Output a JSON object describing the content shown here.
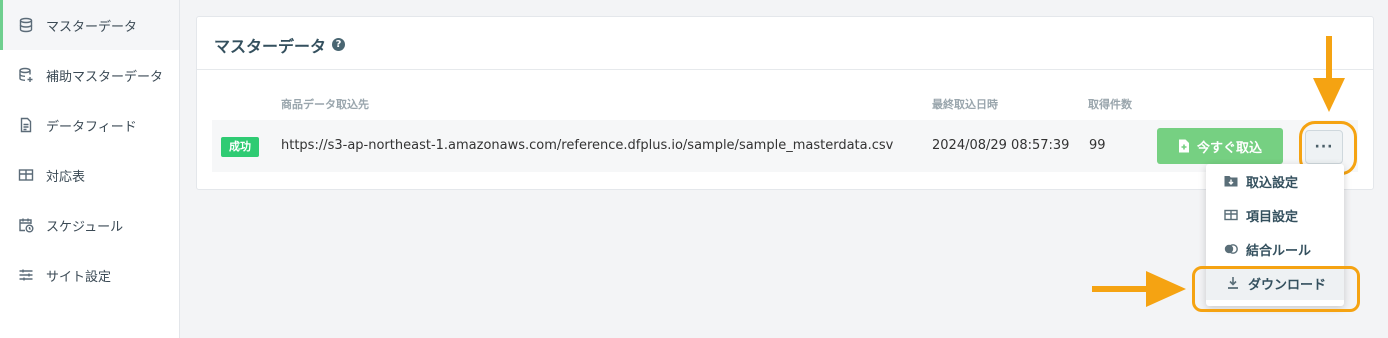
{
  "sidebar": {
    "items": [
      {
        "label": "マスターデータ",
        "icon": "database-icon",
        "active": true
      },
      {
        "label": "補助マスターデータ",
        "icon": "database-add-icon",
        "active": false
      },
      {
        "label": "データフィード",
        "icon": "document-icon",
        "active": false
      },
      {
        "label": "対応表",
        "icon": "table-icon",
        "active": false
      },
      {
        "label": "スケジュール",
        "icon": "calendar-clock-icon",
        "active": false
      },
      {
        "label": "サイト設定",
        "icon": "sliders-icon",
        "active": false
      }
    ]
  },
  "card": {
    "title": "マスターデータ",
    "help_icon": "?",
    "columns": {
      "source": "商品データ取込先",
      "last_import": "最終取込日時",
      "count": "取得件数"
    },
    "row": {
      "status": "成功",
      "url": "https://s3-ap-northeast-1.amazonaws.com/reference.dfplus.io/sample/sample_masterdata.csv",
      "last_import": "2024/08/29 08:57:39",
      "count": "99",
      "import_button": "今すぐ取込",
      "more_button": "···"
    }
  },
  "dropdown": {
    "items": [
      {
        "label": "取込設定",
        "icon": "folder-download-icon"
      },
      {
        "label": "項目設定",
        "icon": "table-icon"
      },
      {
        "label": "結合ルール",
        "icon": "merge-icon"
      },
      {
        "label": "ダウンロード",
        "icon": "download-icon"
      }
    ]
  },
  "colors": {
    "accent_green": "#2fcb73",
    "button_green": "#76d082",
    "annotation_orange": "#f5a312"
  }
}
